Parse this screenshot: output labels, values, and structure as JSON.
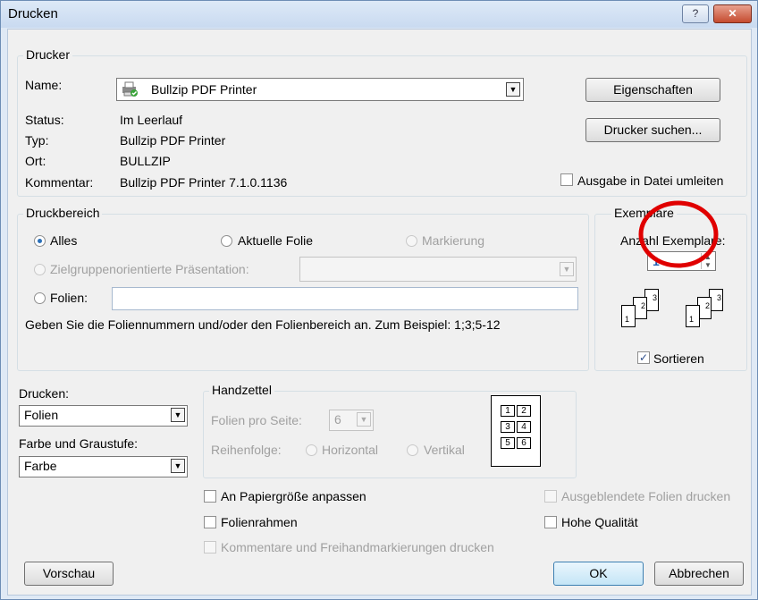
{
  "window": {
    "title": "Drucken",
    "help": "?",
    "close": "✕"
  },
  "printer": {
    "group_label": "Drucker",
    "name_label": "Name:",
    "name_value": "Bullzip PDF Printer",
    "status_label": "Status:",
    "status_value": "Im Leerlauf",
    "type_label": "Typ:",
    "type_value": "Bullzip PDF Printer",
    "location_label": "Ort:",
    "location_value": "BULLZIP",
    "comment_label": "Kommentar:",
    "comment_value": "Bullzip PDF Printer 7.1.0.1136",
    "properties_button": "Eigenschaften",
    "find_button": "Drucker suchen...",
    "print_to_file_label": "Ausgabe in Datei umleiten",
    "print_to_file_checked": false
  },
  "range": {
    "group_label": "Druckbereich",
    "all_label": "Alles",
    "current_slide_label": "Aktuelle Folie",
    "selection_label": "Markierung",
    "custom_show_label": "Zielgruppenorientierte Präsentation:",
    "slides_label": "Folien:",
    "hint": "Geben Sie die Foliennummern und/oder den Folienbereich an. Zum Beispiel: 1;3;5-12",
    "selected": "all"
  },
  "copies": {
    "group_label": "Exemplare",
    "count_label": "Anzahl Exemplare:",
    "count_value": "1",
    "collate_label": "Sortieren",
    "collate_checked": true
  },
  "print_what": {
    "label": "Drucken:",
    "value": "Folien",
    "color_label": "Farbe und Graustufe:",
    "color_value": "Farbe"
  },
  "handouts": {
    "group_label": "Handzettel",
    "per_page_label": "Folien pro Seite:",
    "per_page_value": "6",
    "order_label": "Reihenfolge:",
    "horizontal_label": "Horizontal",
    "vertical_label": "Vertikal",
    "preview_numbers": [
      "1",
      "2",
      "3",
      "4",
      "5",
      "6"
    ]
  },
  "options": {
    "fit_to_paper": "An Papiergröße anpassen",
    "frame_slides": "Folienrahmen",
    "comments": "Kommentare und Freihandmarkierungen drucken",
    "hidden_slides": "Ausgeblendete Folien drucken",
    "high_quality": "Hohe Qualität"
  },
  "footer": {
    "preview_button": "Vorschau",
    "ok_button": "OK",
    "cancel_button": "Abbrechen"
  },
  "colors": {
    "annotation_circle": "#e00000"
  }
}
